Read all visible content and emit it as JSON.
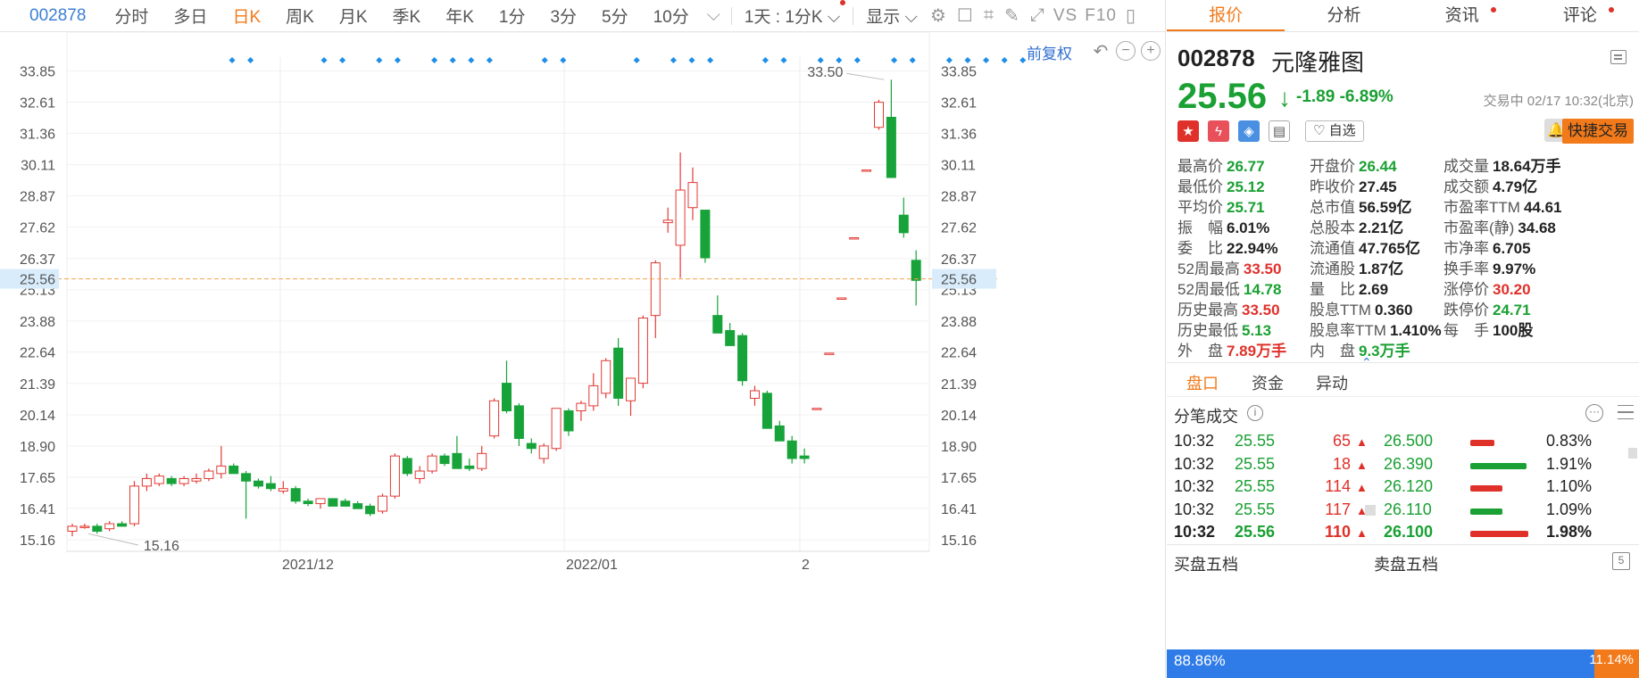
{
  "toolbar": {
    "code": "002878",
    "periods": [
      "分时",
      "多日",
      "日K",
      "周K",
      "月K",
      "季K",
      "年K",
      "1分",
      "3分",
      "5分",
      "10分"
    ],
    "active_period": "日K",
    "range_select": "1天 : 1分K",
    "display_label": "显示",
    "vs_label": "VS",
    "f10_label": "F10"
  },
  "chart_controls": {
    "fuquan_label": "前复权"
  },
  "chart_data": {
    "type": "candlestick",
    "title": "",
    "y_ticks": [
      33.85,
      32.61,
      31.36,
      30.11,
      28.87,
      27.62,
      26.37,
      25.13,
      23.88,
      22.64,
      21.39,
      20.14,
      18.9,
      17.65,
      16.41,
      15.16
    ],
    "ylim": [
      14.7,
      34.4
    ],
    "x_tick_labels": [
      "2021/12",
      "2022/01",
      "2"
    ],
    "current_price": 25.56,
    "high_marker": "33.50",
    "low_marker": "15.16",
    "up_color": "#e23a34",
    "down_color": "#17a33a",
    "candles": [
      [
        15.5,
        15.8,
        15.3,
        15.7
      ],
      [
        15.7,
        15.8,
        15.6,
        15.7
      ],
      [
        15.7,
        15.8,
        15.4,
        15.5
      ],
      [
        15.6,
        15.9,
        15.5,
        15.8
      ],
      [
        15.8,
        15.9,
        15.7,
        15.7
      ],
      [
        15.8,
        17.5,
        15.7,
        17.3
      ],
      [
        17.3,
        17.8,
        17.1,
        17.6
      ],
      [
        17.4,
        17.8,
        17.3,
        17.7
      ],
      [
        17.6,
        17.7,
        17.3,
        17.4
      ],
      [
        17.4,
        17.7,
        17.3,
        17.6
      ],
      [
        17.5,
        17.8,
        17.4,
        17.6
      ],
      [
        17.6,
        18.0,
        17.5,
        17.9
      ],
      [
        17.8,
        18.9,
        17.6,
        18.1
      ],
      [
        18.1,
        18.2,
        17.8,
        17.8
      ],
      [
        17.8,
        17.9,
        16.0,
        17.5
      ],
      [
        17.5,
        17.6,
        17.2,
        17.3
      ],
      [
        17.4,
        17.7,
        17.1,
        17.2
      ],
      [
        17.1,
        17.5,
        17.0,
        17.2
      ],
      [
        17.2,
        17.3,
        16.6,
        16.7
      ],
      [
        16.7,
        16.8,
        16.5,
        16.6
      ],
      [
        16.6,
        16.8,
        16.4,
        16.8
      ],
      [
        16.8,
        16.8,
        16.5,
        16.5
      ],
      [
        16.7,
        16.8,
        16.5,
        16.5
      ],
      [
        16.6,
        16.7,
        16.4,
        16.4
      ],
      [
        16.5,
        16.6,
        16.1,
        16.2
      ],
      [
        16.3,
        17.0,
        16.2,
        16.9
      ],
      [
        16.9,
        18.6,
        16.8,
        18.5
      ],
      [
        18.4,
        18.5,
        17.7,
        17.8
      ],
      [
        17.6,
        18.1,
        17.4,
        17.9
      ],
      [
        17.9,
        18.6,
        17.8,
        18.5
      ],
      [
        18.5,
        18.6,
        18.1,
        18.2
      ],
      [
        18.6,
        19.3,
        18.1,
        18.0
      ],
      [
        18.1,
        18.4,
        17.9,
        18.0
      ],
      [
        18.0,
        18.9,
        17.9,
        18.6
      ],
      [
        19.3,
        20.8,
        19.2,
        20.7
      ],
      [
        21.4,
        22.3,
        20.2,
        20.3
      ],
      [
        20.5,
        20.6,
        18.9,
        19.2
      ],
      [
        19.0,
        19.2,
        18.6,
        18.8
      ],
      [
        18.4,
        19.0,
        18.2,
        18.9
      ],
      [
        18.8,
        20.4,
        18.7,
        20.4
      ],
      [
        20.3,
        20.4,
        19.3,
        19.5
      ],
      [
        20.3,
        20.7,
        19.9,
        20.6
      ],
      [
        20.5,
        21.8,
        20.3,
        21.3
      ],
      [
        21.0,
        22.4,
        20.8,
        22.3
      ],
      [
        22.8,
        23.2,
        20.5,
        20.8
      ],
      [
        20.7,
        21.6,
        20.1,
        21.6
      ],
      [
        21.4,
        24.1,
        21.2,
        24.0
      ],
      [
        24.1,
        26.3,
        23.2,
        26.2
      ],
      [
        27.8,
        28.4,
        27.4,
        27.9
      ],
      [
        26.9,
        30.6,
        25.6,
        29.1
      ],
      [
        28.4,
        30.0,
        27.9,
        29.4
      ],
      [
        28.3,
        28.3,
        26.2,
        26.4
      ],
      [
        24.1,
        24.9,
        23.4,
        23.4
      ],
      [
        23.5,
        23.8,
        22.9,
        22.9
      ],
      [
        23.3,
        23.4,
        21.3,
        21.5
      ],
      [
        20.8,
        21.3,
        20.5,
        21.1
      ],
      [
        21.0,
        21.1,
        19.6,
        19.6
      ],
      [
        19.7,
        19.9,
        19.1,
        19.1
      ],
      [
        19.1,
        19.3,
        18.2,
        18.4
      ],
      [
        18.5,
        18.8,
        18.2,
        18.4
      ],
      [
        20.4,
        20.4,
        20.4,
        20.4
      ],
      [
        22.6,
        22.6,
        22.6,
        22.6
      ],
      [
        24.8,
        24.8,
        24.8,
        24.8
      ],
      [
        27.2,
        27.2,
        27.2,
        27.2
      ],
      [
        29.9,
        29.9,
        29.9,
        29.9
      ],
      [
        31.6,
        32.7,
        31.5,
        32.6
      ],
      [
        32.0,
        33.5,
        29.6,
        29.6
      ],
      [
        28.1,
        28.8,
        27.2,
        27.4
      ],
      [
        26.3,
        26.7,
        24.5,
        25.5
      ]
    ],
    "news_markers": [
      7,
      8,
      12,
      13,
      15,
      16,
      18,
      19,
      20,
      21,
      24,
      25,
      29,
      31,
      32,
      33,
      36,
      37,
      39,
      40,
      41,
      43,
      44,
      46,
      47,
      48,
      49,
      50
    ]
  },
  "right": {
    "tabs": [
      "报价",
      "分析",
      "资讯",
      "评论"
    ],
    "active_tab": "报价",
    "code": "002878",
    "name": "元隆雅图",
    "price": "25.56",
    "change": "-1.89",
    "change_pct": "-6.89%",
    "status_time": "交易中 02/17 10:32(北京)",
    "zixuan_label": "自选",
    "quick_trade_label": "快捷交易",
    "stats_col1": [
      {
        "label": "最高价",
        "value": "26.77",
        "tone": "dn"
      },
      {
        "label": "最低价",
        "value": "25.12",
        "tone": "dn"
      },
      {
        "label": "平均价",
        "value": "25.71",
        "tone": "dn"
      },
      {
        "label": "振　幅",
        "value": "6.01%",
        "tone": "neu"
      },
      {
        "label": "委　比",
        "value": "22.94%",
        "tone": "neu"
      },
      {
        "label": "52周最高",
        "value": "33.50",
        "tone": "up"
      },
      {
        "label": "52周最低",
        "value": "14.78",
        "tone": "dn"
      },
      {
        "label": "历史最高",
        "value": "33.50",
        "tone": "up"
      },
      {
        "label": "历史最低",
        "value": "5.13",
        "tone": "dn"
      },
      {
        "label": "外　盘",
        "value": "7.89万手",
        "tone": "up"
      }
    ],
    "stats_col2": [
      {
        "label": "开盘价",
        "value": "26.44",
        "tone": "dn"
      },
      {
        "label": "昨收价",
        "value": "27.45",
        "tone": "neu"
      },
      {
        "label": "总市值",
        "value": "56.59亿",
        "tone": "neu"
      },
      {
        "label": "总股本",
        "value": "2.21亿",
        "tone": "neu"
      },
      {
        "label": "流通值",
        "value": "47.765亿",
        "tone": "neu"
      },
      {
        "label": "流通股",
        "value": "1.87亿",
        "tone": "neu"
      },
      {
        "label": "量　比",
        "value": "2.69",
        "tone": "neu"
      },
      {
        "label": "股息TTM",
        "value": "0.360",
        "tone": "neu"
      },
      {
        "label": "股息率TTM",
        "value": "1.410%",
        "tone": "neu"
      },
      {
        "label": "内　盘",
        "value": "9.3万手",
        "tone": "dn"
      }
    ],
    "stats_col3": [
      {
        "label": "成交量",
        "value": "18.64万手",
        "tone": "neu"
      },
      {
        "label": "成交额",
        "value": "4.79亿",
        "tone": "neu"
      },
      {
        "label": "市盈率TTM",
        "value": "44.61",
        "tone": "neu"
      },
      {
        "label": "市盈率(静)",
        "value": "34.68",
        "tone": "neu"
      },
      {
        "label": "市净率",
        "value": "6.705",
        "tone": "neu"
      },
      {
        "label": "换手率",
        "value": "9.97%",
        "tone": "neu"
      },
      {
        "label": "涨停价",
        "value": "30.20",
        "tone": "up"
      },
      {
        "label": "跌停价",
        "value": "24.71",
        "tone": "dn"
      },
      {
        "label": "每　手",
        "value": "100股",
        "tone": "neu"
      }
    ],
    "subtabs": [
      "盘口",
      "资金",
      "异动"
    ],
    "active_subtab": "盘口",
    "trades_title": "分笔成交",
    "trades": [
      {
        "time": "10:32",
        "price": "25.55",
        "vol": "65",
        "book_price": "26.500",
        "bar_pct": 0.83,
        "bar_color": "#e0302a",
        "pct": "0.83%"
      },
      {
        "time": "10:32",
        "price": "25.55",
        "vol": "18",
        "book_price": "26.390",
        "bar_pct": 1.91,
        "bar_color": "#1aa033",
        "pct": "1.91%"
      },
      {
        "time": "10:32",
        "price": "25.55",
        "vol": "114",
        "book_price": "26.120",
        "bar_pct": 1.1,
        "bar_color": "#e0302a",
        "pct": "1.10%"
      },
      {
        "time": "10:32",
        "price": "25.55",
        "vol": "117",
        "book_price": "26.110",
        "bar_pct": 1.09,
        "bar_color": "#1aa033",
        "pct": "1.09%"
      },
      {
        "time": "10:32",
        "price": "25.56",
        "vol": "110",
        "book_price": "26.100",
        "bar_pct": 1.98,
        "bar_color": "#e0302a",
        "pct": "1.98%"
      }
    ],
    "buy_five": "买盘五档",
    "sell_five": "卖盘五档",
    "buy_ratio": "88.86%",
    "sell_ratio": "11.14%"
  }
}
